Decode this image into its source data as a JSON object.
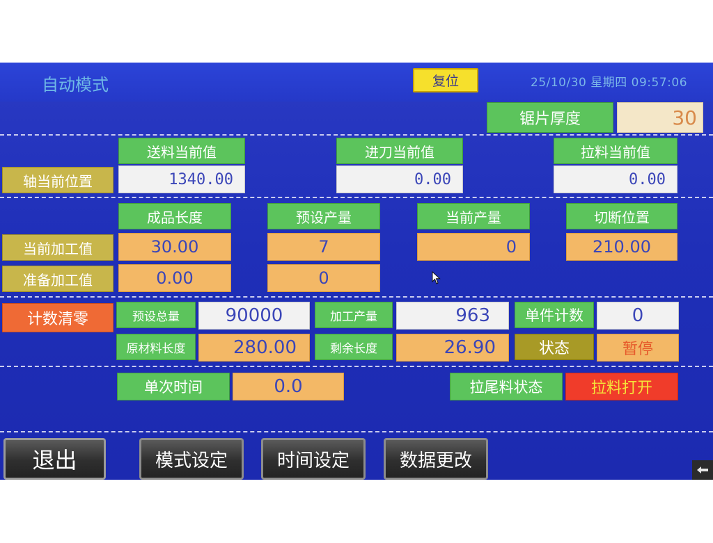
{
  "header": {
    "title": "自动模式",
    "reset_label": "复位",
    "datetime": "25/10/30 星期四 09:57:06"
  },
  "blade": {
    "label": "锯片厚度",
    "value": "30"
  },
  "axis": {
    "row_label": "轴当前位置",
    "columns": [
      {
        "label": "送料当前值",
        "value": "1340.00"
      },
      {
        "label": "进刀当前值",
        "value": "0.00"
      },
      {
        "label": "拉料当前值",
        "value": "0.00"
      }
    ]
  },
  "processing": {
    "headers": [
      "成品长度",
      "预设产量",
      "当前产量",
      "切断位置"
    ],
    "current_label": "当前加工值",
    "current_values": [
      "30.00",
      "7",
      "0",
      "210.00"
    ],
    "prepare_label": "准备加工值",
    "prepare_values": [
      "0.00",
      "0"
    ]
  },
  "counters": {
    "reset_count_label": "计数清零",
    "preset_total_label": "预设总量",
    "preset_total_value": "90000",
    "processed_label": "加工产量",
    "processed_value": "963",
    "unit_count_label": "单件计数",
    "unit_count_value": "0",
    "material_length_label": "原材料长度",
    "material_length_value": "280.00",
    "remaining_label": "剩余长度",
    "remaining_value": "26.90",
    "status_label": "状态",
    "status_value": "暂停"
  },
  "timing": {
    "single_time_label": "单次时间",
    "single_time_value": "0.0",
    "tail_status_label": "拉尾料状态",
    "tail_status_value": "拉料打开"
  },
  "bottom": {
    "exit": "退出",
    "mode_setting": "模式设定",
    "time_setting": "时间设定",
    "data_change": "数据更改"
  },
  "icons": {
    "back": "back-arrow-icon",
    "cursor": "mouse-cursor-icon"
  },
  "colors": {
    "screen_bg": "#1f2fb8",
    "green_label": "#5cc45c",
    "orange_value": "#f3b866",
    "reset_yellow": "#f6e02c",
    "red_state": "#f03c2a"
  }
}
